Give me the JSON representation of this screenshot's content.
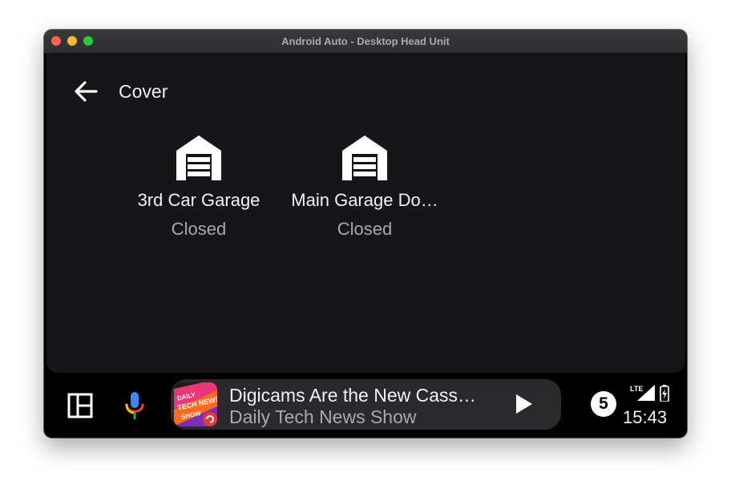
{
  "window": {
    "title": "Android Auto - Desktop Head Unit"
  },
  "header": {
    "title": "Cover"
  },
  "tiles": [
    {
      "name": "3rd Car Garage",
      "state": "Closed",
      "icon": "garage-icon"
    },
    {
      "name": "Main Garage Do…",
      "state": "Closed",
      "icon": "garage-icon"
    }
  ],
  "media": {
    "title": "Digicams Are the New Cass…",
    "subtitle": "Daily Tech News Show",
    "artwork_text": "DAILY TECH NEWS SHOW",
    "play_icon": "play-icon"
  },
  "status": {
    "notification_count": "5",
    "network": "LTE",
    "time": "15:43"
  },
  "colors": {
    "background": "#000000",
    "surface": "#161618",
    "media_card": "#2a2a2d",
    "text_primary": "#f2f2f2",
    "text_secondary": "#a9a9ad"
  }
}
